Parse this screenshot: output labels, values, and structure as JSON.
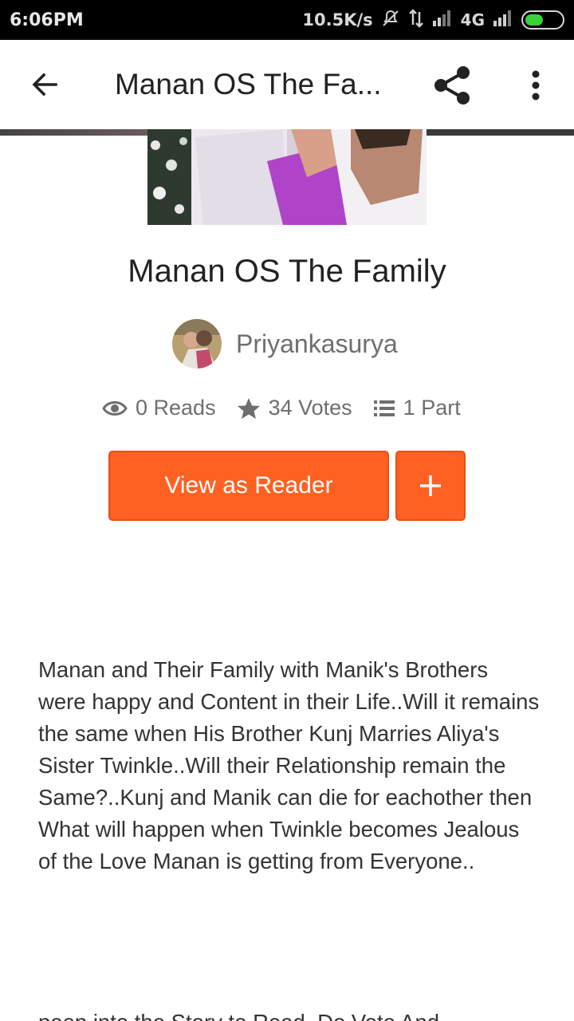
{
  "status_bar": {
    "time": "6:06PM",
    "speed": "10.5K/s",
    "network": "4G"
  },
  "toolbar": {
    "title": "Manan OS The Fa..."
  },
  "story": {
    "title": "Manan OS The Family",
    "author": "Priyankasurya",
    "stats": {
      "reads": "0 Reads",
      "votes": "34 Votes",
      "parts": "1 Part"
    },
    "view_button": "View as Reader",
    "description": "Manan and Their Family with Manik's Brothers were happy and Content in their Life..Will it remains the same when His Brother Kunj Marries Aliya's Sister Twinkle..Will their Relationship remain the Same?..Kunj and Manik can die for eachother then What will happen when Twinkle becomes Jealous of the Love Manan is getting from Everyone..",
    "description_continued": "peep into the Story to Read..Do Vote And"
  },
  "colors": {
    "accent": "#ff6122",
    "battery": "#3ad13a"
  }
}
